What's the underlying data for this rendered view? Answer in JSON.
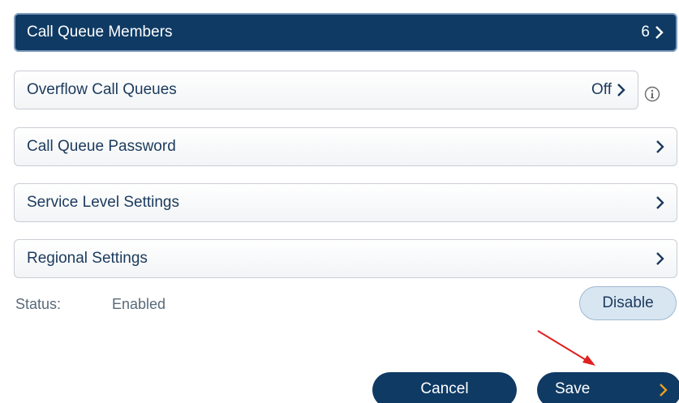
{
  "settings": {
    "rows": [
      {
        "label": "Call Queue Members",
        "value": "6",
        "icon": "chevron-right-icon"
      },
      {
        "label": "Overflow Call Queues",
        "value": "Off",
        "icon": "chevron-right-icon"
      },
      {
        "label": "Call Queue Password",
        "value": "",
        "icon": "chevron-right-icon"
      },
      {
        "label": "Service Level Settings",
        "value": "",
        "icon": "chevron-right-icon"
      },
      {
        "label": "Regional Settings",
        "value": "",
        "icon": "chevron-right-icon"
      }
    ],
    "info_icon": "info-icon"
  },
  "status": {
    "label": "Status:",
    "value": "Enabled",
    "disable_label": "Disable"
  },
  "footer": {
    "cancel_label": "Cancel",
    "save_label": "Save"
  },
  "colors": {
    "primary": "#0f3a64",
    "text": "#1b3a5c",
    "disable_bg": "#d8e6f2",
    "annotation_arrow": "#e02020"
  }
}
